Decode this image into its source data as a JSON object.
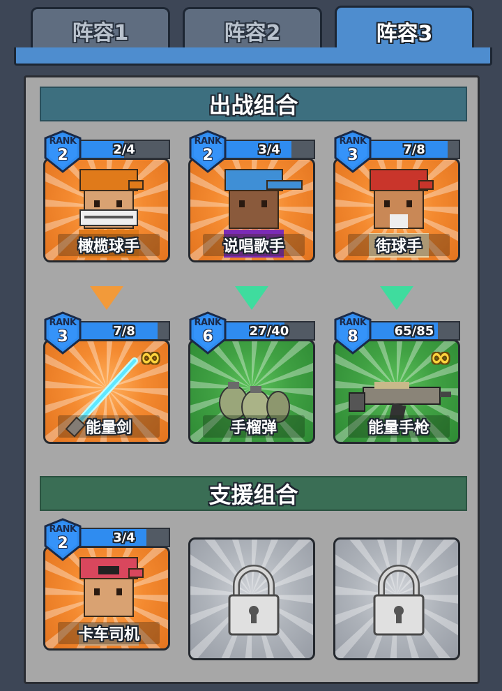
{
  "tabs": [
    {
      "label": "阵容1",
      "active": false
    },
    {
      "label": "阵容2",
      "active": false
    },
    {
      "label": "阵容3",
      "active": true
    }
  ],
  "battle_section": {
    "title": "出战组合"
  },
  "support_section": {
    "title": "支援组合"
  },
  "rank_label": "RANK",
  "characters": [
    {
      "name": "橄榄球手",
      "rank": "2",
      "progress_text": "2/4",
      "progress": 0.5,
      "bg": "orange",
      "icon": "football-player-portrait"
    },
    {
      "name": "说唱歌手",
      "rank": "2",
      "progress_text": "3/4",
      "progress": 0.75,
      "bg": "orange",
      "icon": "rapper-portrait"
    },
    {
      "name": "街球手",
      "rank": "3",
      "progress_text": "7/8",
      "progress": 0.875,
      "bg": "orange",
      "icon": "streetball-player-portrait"
    }
  ],
  "weapons": [
    {
      "name": "能量剑",
      "rank": "3",
      "progress_text": "7/8",
      "progress": 0.875,
      "bg": "orange",
      "infinite": true,
      "icon": "energy-sword-icon"
    },
    {
      "name": "手榴弹",
      "rank": "6",
      "progress_text": "27/40",
      "progress": 0.675,
      "bg": "green",
      "infinite": false,
      "icon": "grenade-icon"
    },
    {
      "name": "能量手枪",
      "rank": "8",
      "progress_text": "65/85",
      "progress": 0.765,
      "bg": "green",
      "infinite": true,
      "icon": "energy-pistol-icon"
    }
  ],
  "arrows": [
    {
      "color": "#f29a3a"
    },
    {
      "color": "#3fdc9e"
    },
    {
      "color": "#3fdc9e"
    }
  ],
  "support": [
    {
      "name": "卡车司机",
      "rank": "2",
      "progress_text": "3/4",
      "progress": 0.75,
      "bg": "orange",
      "icon": "truck-driver-portrait"
    }
  ],
  "locked_slots": [
    {
      "icon": "padlock-icon"
    },
    {
      "icon": "padlock-icon"
    }
  ],
  "infinity_symbol": "∞",
  "colors": {
    "tab_active": "#4e8dcf",
    "tab_inactive": "#5f6d80",
    "battle_header": "#3d6f7f",
    "support_header": "#3a6e55",
    "panel": "#a7a7a7",
    "progress_fill": "#2f8cf0",
    "rank_badge": "#2f8cf0"
  }
}
